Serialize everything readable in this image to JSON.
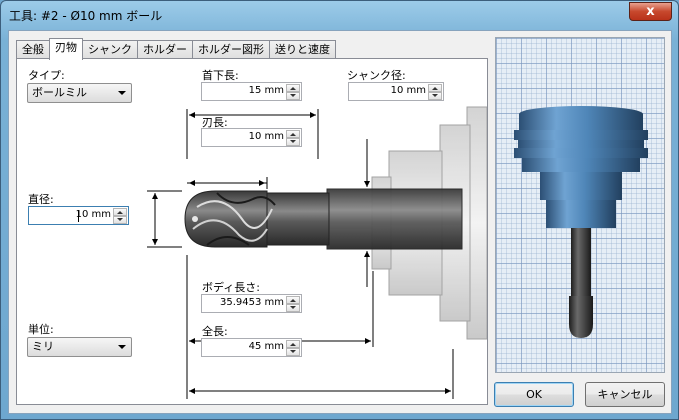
{
  "window": {
    "title": "工具: #2 - Ø10 mm ボール",
    "close_label": "x"
  },
  "tabs": [
    {
      "label": "全般"
    },
    {
      "label": "刃物"
    },
    {
      "label": "シャンク"
    },
    {
      "label": "ホルダー"
    },
    {
      "label": "ホルダー図形"
    },
    {
      "label": "送りと速度"
    }
  ],
  "active_tab": "刃物",
  "fields": {
    "type_label": "タイプ:",
    "type_value": "ボールミル",
    "neck_length_label": "首下長:",
    "neck_length_value": "15 mm",
    "shank_diameter_label": "シャンク径:",
    "shank_diameter_value": "10 mm",
    "flute_length_label": "刃長:",
    "flute_length_value": "10 mm",
    "diameter_label": "直径:",
    "diameter_value": "10 mm",
    "body_length_label": "ボディ長さ:",
    "body_length_value": "35.9453 mm",
    "overall_length_label": "全長:",
    "overall_length_value": "45 mm",
    "unit_label": "単位:",
    "unit_value": "ミリ"
  },
  "buttons": {
    "ok": "OK",
    "cancel": "キャンセル"
  },
  "colors": {
    "tool_steel": "#5a5a5a",
    "holder_blue": "#4f86b8",
    "grid": "#e6eef6"
  },
  "icons": {
    "spin": "spin-arrows-icon",
    "dropdown": "chevron-down-icon"
  }
}
